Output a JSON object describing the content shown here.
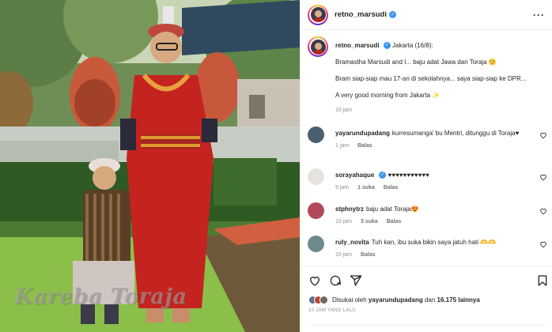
{
  "photo": {
    "watermark": "Kareba Toraja"
  },
  "post": {
    "username": "retno_marsudi",
    "verified": true,
    "more_icon": "more-horizontal-icon",
    "location": "Jakarta (16/8):",
    "caption_lines": [
      "Bramastha Marsudi and I... baju adat Jawa dan Toraja ☺️",
      "Bram siap-siap mau 17-an di sekolahnya... saya siap-siap ke DPR...",
      "A very good morning from Jakarta ✨"
    ],
    "caption_time": "10 jam"
  },
  "comments": [
    {
      "user": "yayarundupadang",
      "verified": false,
      "text": "kurresumanga' bu Mentri, ditunggu di Toraja♥",
      "time": "1 jam",
      "likes": "",
      "reply": "Balas"
    },
    {
      "user": "sorayahaque",
      "verified": true,
      "text": "♥♥♥♥♥♥♥♥♥♥♥",
      "time": "9 jam",
      "likes": "1 suka",
      "reply": "Balas"
    },
    {
      "user": "stphnytrz",
      "verified": false,
      "text": "baju adat Toraja😍",
      "time": "10 jam",
      "likes": "3 suka",
      "reply": "Balas"
    },
    {
      "user": "ruly_novita",
      "verified": false,
      "text": "Tuh kan, ibu suka bikin saya jatuh hati 🫶🫶",
      "time": "10 jam",
      "likes": "",
      "reply": "Balas"
    }
  ],
  "actions": {
    "icons": [
      "heart-icon",
      "comment-icon",
      "share-icon",
      "bookmark-icon"
    ],
    "liked_by_prefix": "Disukai oleh",
    "liked_by_user": "yayarundupadang",
    "liked_by_connector": "dan",
    "liked_by_count": "16.175 lainnya",
    "post_time": "10 JAM YANG LALU"
  },
  "colors": {
    "verified": "#3897f0",
    "muted": "#8e8e8e",
    "text": "#262626"
  }
}
